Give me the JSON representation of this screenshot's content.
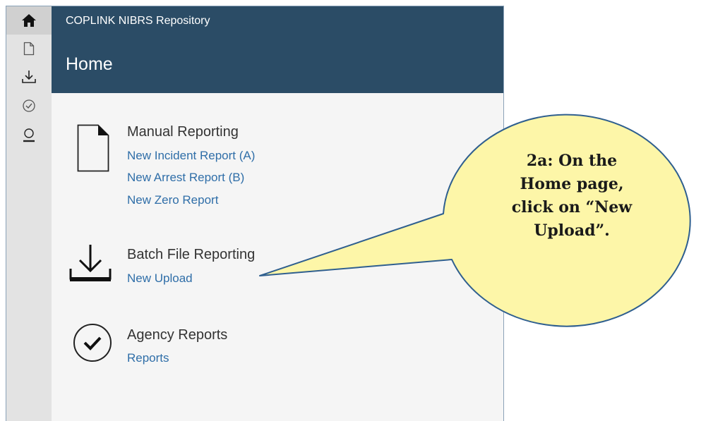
{
  "app": {
    "name": "COPLINK NIBRS Repository",
    "page_title": "Home"
  },
  "rail": [
    {
      "icon": "home-icon",
      "active": true
    },
    {
      "icon": "document-icon",
      "active": false
    },
    {
      "icon": "download-icon",
      "active": false
    },
    {
      "icon": "check-circle-icon",
      "active": false
    },
    {
      "icon": "user-icon",
      "active": false
    }
  ],
  "sections": {
    "manual": {
      "title": "Manual Reporting",
      "icon": "document-icon",
      "links": [
        "New Incident Report (A)",
        "New Arrest Report (B)",
        "New Zero Report"
      ]
    },
    "batch": {
      "title": "Batch File Reporting",
      "icon": "download-icon",
      "links": [
        "New Upload"
      ]
    },
    "agency": {
      "title": "Agency Reports",
      "icon": "check-circle-icon",
      "links": [
        "Reports"
      ]
    }
  },
  "callout": {
    "lines": [
      "2a: On the",
      "Home page,",
      "click on “New",
      "Upload”."
    ],
    "fill": "#fdf6a8",
    "stroke": "#2f5f8f"
  },
  "colors": {
    "header": "#2b4c66",
    "link": "#2f6ea8",
    "rail": "#e3e3e3"
  }
}
